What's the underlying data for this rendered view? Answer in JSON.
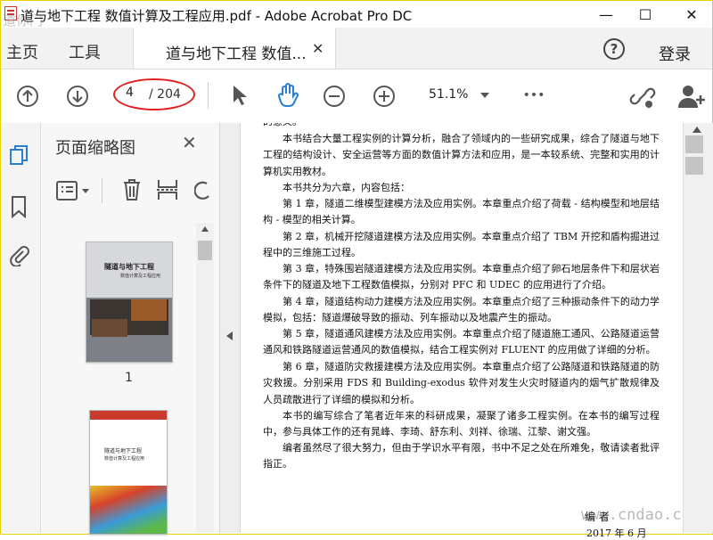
{
  "window": {
    "title": "道与地下工程 数值计算及工程应用.pdf - Adobe Acrobat Pro DC",
    "watermark_tl": "道你门",
    "min_glyph": "—",
    "max_glyph": "☐",
    "close_glyph": "✕"
  },
  "menu": {
    "home": "主页",
    "tools": "工具",
    "login": "登录",
    "help": "?"
  },
  "tab": {
    "label": "道与地下工程 数值...",
    "close": "✕"
  },
  "toolbar": {
    "page_current": "4",
    "page_total": "/ 204",
    "zoom": "51.1%",
    "more": "•••"
  },
  "thumbnails": {
    "title": "页面缩略图",
    "close": "✕",
    "page1_label": "1",
    "cover1": {
      "title": "隧道与地下工程",
      "subtitle": "数值计算及工程应用"
    },
    "cover2": {
      "title": "隧道与地下工程",
      "subtitle": "数值计算及工程应用"
    }
  },
  "doc": {
    "top_partial": "的意义。",
    "paragraphs": [
      "本书结合大量工程实例的计算分析，融合了领域内的一些研究成果，综合了隧道与地下工程的结构设计、安全运营等方面的数值计算方法和应用，是一本较系统、完整和实用的计算机实用教材。",
      "本书共分为六章，内容包括：",
      "第 1 章，隧道二维模型建模方法及应用实例。本章重点介绍了荷载 - 结构模型和地层结构 - 模型的相关计算。",
      "第 2 章，机械开挖隧道建模方法及应用实例。本章重点介绍了 TBM 开挖和盾构掘进过程中的三维施工过程。",
      "第 3 章，特殊围岩隧道建模方法及应用实例。本章重点介绍了卵石地层条件下和层状岩条件下的隧道及地下工程数值模拟，分别对 PFC 和 UDEC 的应用进行了介绍。",
      "第 4 章，隧道结构动力建模方法及应用实例。本章重点介绍了三种振动条件下的动力学模拟，包括：隧道爆破导致的振动、列车振动以及地震产生的振动。",
      "第 5 章，隧道通风建模方法及应用实例。本章重点介绍了隧道施工通风、公路隧道运营通风和铁路隧道运营通风的数值模拟，结合工程实例对 FLUENT 的应用做了详细的分析。",
      "第 6 章，隧道防灾救援建模方法及应用实例。本章重点介绍了公路隧道和铁路隧道的防灾救援。分别采用 FDS 和 Building-exodus 软件对发生火灾时隧道内的烟气扩散规律及人员疏散进行了详细的模拟和分析。",
      "本书的编写综合了笔者近年来的科研成果，凝聚了诸多工程实例。在本书的编写过程中，参与具体工作的还有晁峰、李琦、舒东利、刘祥、徐瑞、江黎、谢文强。",
      "编者虽然尽了很大努力，但由于学识水平有限，书中不足之处在所难免，敬请读者批评指正。"
    ],
    "signature": "编 者",
    "date": "2017 年 6 月",
    "watermark": "www.cndao.com"
  }
}
